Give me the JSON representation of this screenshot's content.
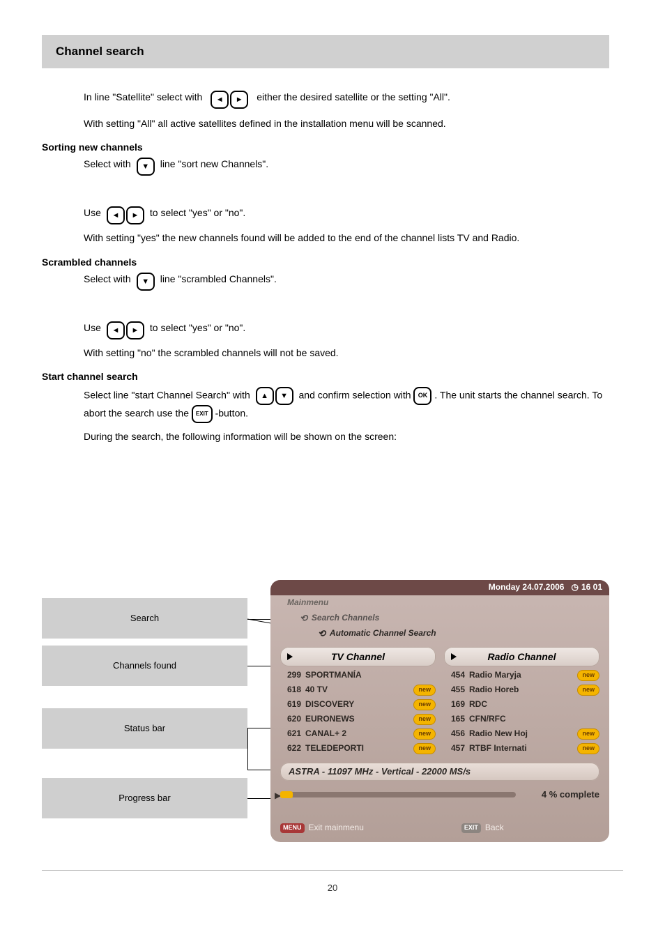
{
  "header": "Channel search",
  "intro": {
    "p1_a": "In line \"Satellite\" select with",
    "p1_b": "either the desired satellite or the setting \"All\".",
    "p2": "With setting \"All\" all active satellites defined in the installation menu will be scanned."
  },
  "sortingNewChannels": {
    "title": "Sorting new channels",
    "line1_a": "Select with",
    "line1_b": "line \"sort new Channels\".",
    "line2_a": "Use",
    "line2_b": "to select \"yes\" or \"no\".",
    "note": "With setting \"yes\" the new channels found will be added to the end of the channel lists TV and Radio."
  },
  "scrambledChannels": {
    "title": "Scrambled channels",
    "line1_a": "Select with",
    "line1_b": "line \"scrambled Channels\".",
    "line2_a": "Use",
    "line2_b": "to select \"yes\" or \"no\".",
    "note": "With setting \"no\" the scrambled channels will not be saved."
  },
  "startSearch": {
    "title": "Start channel search",
    "p1_a": "Select line \"start Channel Search\" with",
    "p1_b": "and confirm selection with",
    "p1_c": ". The unit starts the channel search. To abort the search use the",
    "p1_d": "-button.",
    "p2": "During the search, the following information will be shown on the screen:"
  },
  "callouts": {
    "c1": "Search",
    "c2": "Channels found",
    "c3": "Status bar",
    "c4": "Progress bar"
  },
  "shot": {
    "date": "Monday 24.07.2006",
    "time": "16 01",
    "crumb1": "Mainmenu",
    "crumb2": "Search Channels",
    "crumb3": "Automatic Channel Search",
    "tabTV": "TV Channel",
    "tabRadio": "Radio Channel",
    "tv": [
      {
        "num": "299",
        "name": "SPORTMANÍA",
        "new": false
      },
      {
        "num": "618",
        "name": "40 TV",
        "new": true
      },
      {
        "num": "619",
        "name": "DISCOVERY",
        "new": true
      },
      {
        "num": "620",
        "name": "EURONEWS",
        "new": true
      },
      {
        "num": "621",
        "name": "CANAL+ 2",
        "new": true
      },
      {
        "num": "622",
        "name": "TELEDEPORTI",
        "new": true
      }
    ],
    "radio": [
      {
        "num": "454",
        "name": "Radio Maryja",
        "new": true
      },
      {
        "num": "455",
        "name": "Radio Horeb",
        "new": true
      },
      {
        "num": "169",
        "name": "RDC",
        "new": false
      },
      {
        "num": "165",
        "name": "CFN/RFC",
        "new": false
      },
      {
        "num": "456",
        "name": "Radio New Hoj",
        "new": true
      },
      {
        "num": "457",
        "name": "RTBF Internati",
        "new": true
      }
    ],
    "status": "ASTRA - 11097 MHz - Vertical - 22000 MS/s",
    "progressLabel": "4 % complete",
    "footMenuPill": "MENU",
    "footMenu": "Exit mainmenu",
    "footExitPill": "EXIT",
    "footExit": "Back",
    "newBadge": "new"
  },
  "keys": {
    "ok": "OK",
    "exit": "EXIT"
  },
  "pageNo": "20"
}
